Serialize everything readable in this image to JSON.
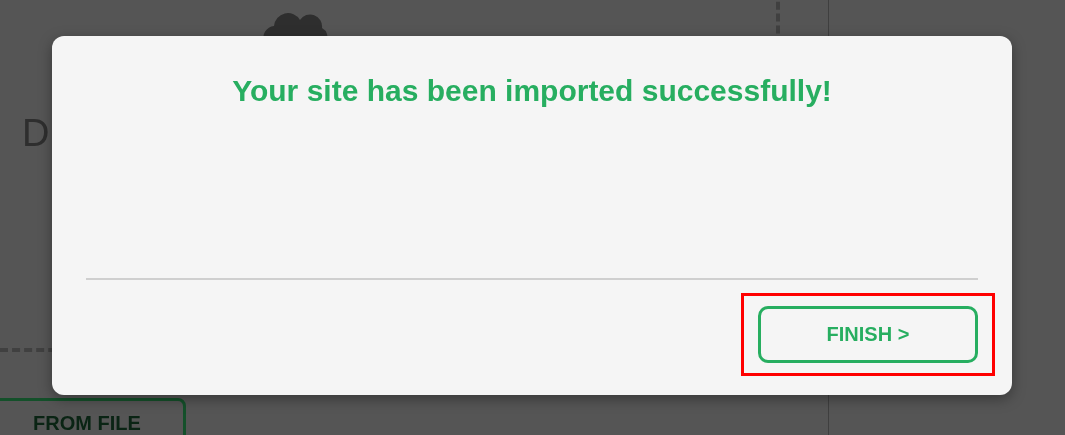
{
  "background": {
    "heading": "D",
    "button": "FROM FILE"
  },
  "dialog": {
    "title": "Your site has been imported successfully!",
    "finish_button": {
      "label": "FINISH >",
      "highlighted": true
    }
  }
}
